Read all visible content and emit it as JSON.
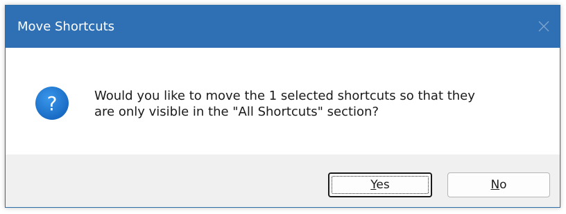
{
  "window": {
    "title": "Move Shortcuts",
    "titlebar_color": "#2f6fb3",
    "close_icon": "close-icon"
  },
  "dialog": {
    "icon": "question-icon",
    "icon_color": "#1f7cd6",
    "message_line1": "Would you like to move the 1 selected shortcuts so that they",
    "message_line2": "are only visible in the \"All Shortcuts\" section?"
  },
  "buttons": {
    "yes_mnemonic": "Y",
    "yes_rest": "es",
    "no_mnemonic": "N",
    "no_rest": "o",
    "default": "yes"
  }
}
